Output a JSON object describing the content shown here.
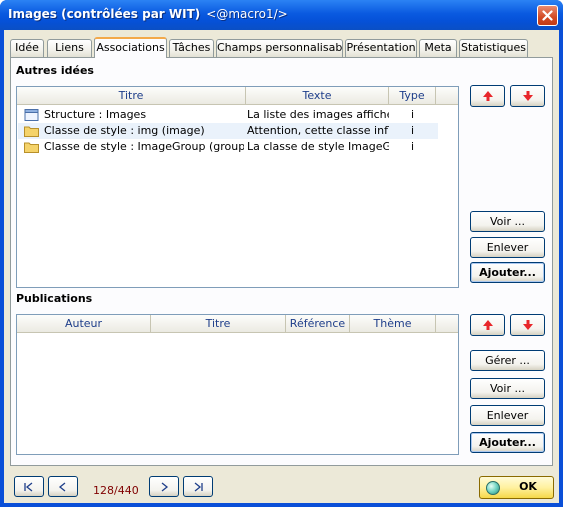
{
  "window": {
    "title": "Images (contrôlées par WIT)",
    "title_suffix": "<@macro1/>",
    "close_icon": "close-icon"
  },
  "tabs": [
    {
      "label": "Idée",
      "active": false
    },
    {
      "label": "Liens",
      "active": false
    },
    {
      "label": "Associations",
      "active": true
    },
    {
      "label": "Tâches",
      "active": false
    },
    {
      "label": "Champs personnalisables",
      "active": false
    },
    {
      "label": "Présentation",
      "active": false
    },
    {
      "label": "Meta",
      "active": false
    },
    {
      "label": "Statistiques",
      "active": false
    }
  ],
  "ideas": {
    "label": "Autres idées",
    "columns": [
      "Titre",
      "Texte",
      "Type"
    ],
    "rows": [
      {
        "icon": "document-icon",
        "title": "Structure : Images",
        "text": "La liste des images affiche l...",
        "type": "i",
        "selected": false
      },
      {
        "icon": "folder-icon",
        "title": "Classe de style : img (image)",
        "text": "Attention, cette classe influe...",
        "type": "i",
        "selected": true
      },
      {
        "icon": "folder-icon",
        "title": "Classe de style : ImageGroup (groupe de...",
        "text": "La classe de style ImageGro...",
        "type": "i",
        "selected": false
      }
    ],
    "buttons": {
      "view": "Voir ...",
      "remove": "Enlever",
      "add": "Ajouter..."
    }
  },
  "publications": {
    "label": "Publications",
    "columns": [
      "Auteur",
      "Titre",
      "Référence",
      "Thème"
    ],
    "buttons": {
      "manage": "Gérer ...",
      "view": "Voir ...",
      "remove": "Enlever",
      "add": "Ajouter..."
    }
  },
  "footer": {
    "counter": "128/440",
    "ok_label": "OK"
  },
  "colors": {
    "accent_red": "#e8262a",
    "title_blue": "#0a5ae0",
    "counter_text": "#800000"
  }
}
